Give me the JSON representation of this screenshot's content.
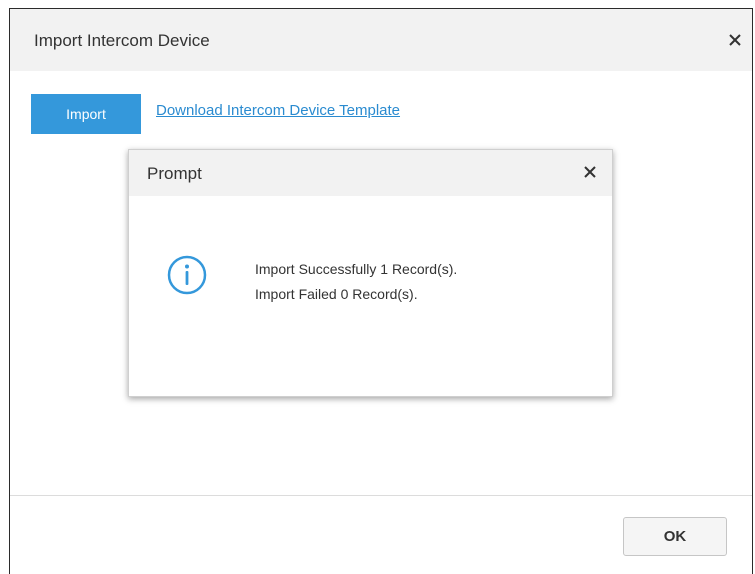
{
  "dialog": {
    "title": "Import Intercom Device",
    "close_icon": "close-icon",
    "import_label": "Import",
    "template_link": "Download Intercom Device Template",
    "ok_label": "OK"
  },
  "prompt": {
    "title": "Prompt",
    "close_icon": "close-icon",
    "icon": "info-icon",
    "messages": [
      "Import Successfully 1 Record(s).",
      "Import Failed 0 Record(s)."
    ]
  },
  "colors": {
    "accent": "#3498db",
    "link": "#2a8bd0",
    "header_bg": "#f2f2f2"
  }
}
